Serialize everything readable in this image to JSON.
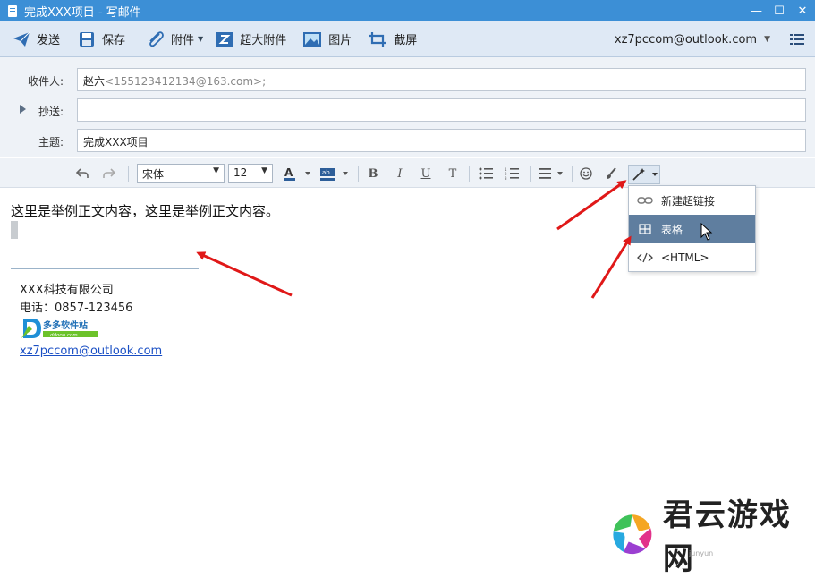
{
  "window": {
    "title": "完成XXX项目 - 写邮件",
    "controls": {
      "minimize": "—",
      "maximize": "☐",
      "close": "✕"
    }
  },
  "toolbar": {
    "send_label": "发送",
    "save_label": "保存",
    "attach_label": "附件",
    "big_attach_label": "超大附件",
    "image_label": "图片",
    "screenshot_label": "截屏",
    "account": "xz7pccom@outlook.com"
  },
  "header": {
    "to_label": "收件人:",
    "to_contact": "赵六",
    "to_email": "<155123412134@163.com>;",
    "cc_label": "抄送:",
    "cc_value": "",
    "subject_label": "主题:",
    "subject_value": "完成XXX项目"
  },
  "format": {
    "font_family": "宋体",
    "font_size": "12"
  },
  "body": {
    "text": "这里是举例正文内容，这里是举例正文内容。",
    "signature": {
      "company": "XXX科技有限公司",
      "phone": "电话：0857-123456",
      "email": "xz7pccom@outlook.com",
      "logo_text": "多多软件站",
      "logo_sub": "ddooo.com"
    }
  },
  "popup_menu": {
    "items": [
      {
        "label": "新建超链接",
        "icon": "link-icon",
        "highlighted": false
      },
      {
        "label": "表格",
        "icon": "table-icon",
        "highlighted": true
      },
      {
        "label": "<HTML>",
        "icon": "code-icon",
        "highlighted": false
      }
    ]
  },
  "watermark": {
    "text": "君云游戏网",
    "sub": "junyun"
  },
  "colors": {
    "titlebar": "#3c8fd6",
    "toolbar": "#dfe9f5",
    "highlight": "#5f7e9f",
    "arrow": "#e01818",
    "link": "#1a4fc4"
  }
}
